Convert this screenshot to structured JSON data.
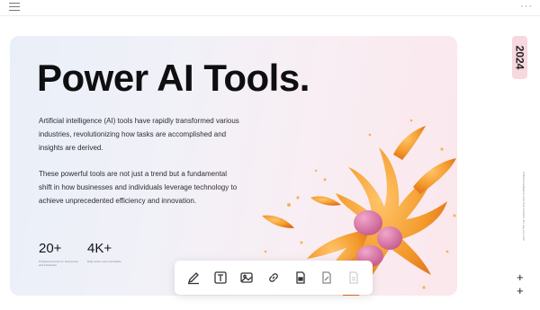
{
  "hero": {
    "title": "Power AI Tools.",
    "paragraph1": "Artificial intelligence (AI) tools have rapidly transformed various industries, revolutionizing how tasks are accomplished and insights are derived.",
    "paragraph2": "These powerful tools are not just a trend but a fundamental shift in how businesses and individuals leverage technology to achieve unprecedented efficiency and innovation."
  },
  "stats": [
    {
      "value": "20+",
      "caption": "Professional tools for businesses and individuals"
    },
    {
      "value": "4K+",
      "caption": "Daily active users worldwide"
    }
  ],
  "sidebar": {
    "year": "2024",
    "side_text": "Artificial intelligence tools that transform the way you work",
    "plus_label": "+"
  },
  "toolbar": {
    "tools": [
      "pen-edit-icon",
      "text-tool-icon",
      "image-icon",
      "link-icon",
      "file-icon",
      "file-edit-icon",
      "file-disabled-icon"
    ]
  },
  "colors": {
    "accent_orange": "#f39a2b",
    "accent_pink": "#d77aa6",
    "badge_bg": "#f7d8df"
  }
}
